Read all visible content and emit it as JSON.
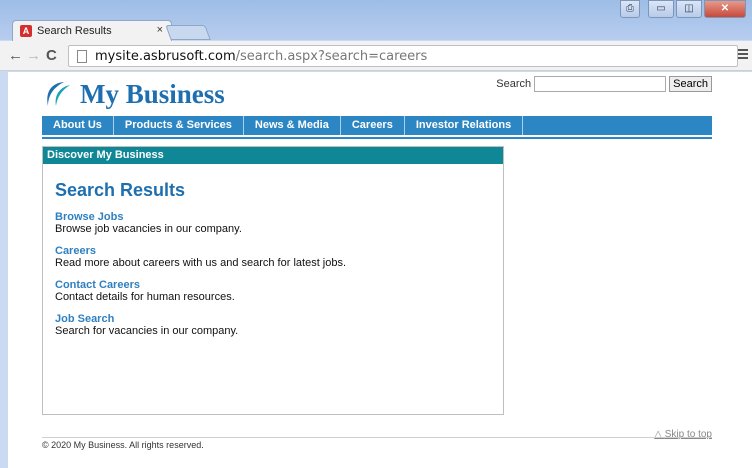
{
  "browser": {
    "tab_title": "Search Results",
    "tab_close": "×",
    "url_host": "mysite.asbrusoft.com",
    "url_path": "/search.aspx?search=careers",
    "window_buttons": {
      "user": "⎙",
      "minimize": "▭",
      "maximize": "◫",
      "close": "✕"
    },
    "nav": {
      "back": "←",
      "forward": "→",
      "reload": "C"
    }
  },
  "site": {
    "logo_text": "My Business",
    "search": {
      "label": "Search",
      "value": "",
      "button": "Search"
    },
    "nav_items": [
      "About Us",
      "Products & Services",
      "News & Media",
      "Careers",
      "Investor Relations"
    ],
    "panel_title": "Discover My Business",
    "results_title": "Search Results",
    "results": [
      {
        "title": "Browse Jobs",
        "desc": "Browse job vacancies in our company."
      },
      {
        "title": "Careers",
        "desc": "Read more about careers with us and search for latest jobs."
      },
      {
        "title": "Contact Careers",
        "desc": "Contact details for human resources."
      },
      {
        "title": "Job Search",
        "desc": "Search for vacancies in our company."
      }
    ],
    "skip_to_top": "Skip to top",
    "copyright": "© 2020 My Business. All rights reserved."
  },
  "colors": {
    "brand": "#1e6fb0",
    "nav": "#2d86c4",
    "panel_header": "#0f8796",
    "link": "#2f7fc1"
  }
}
